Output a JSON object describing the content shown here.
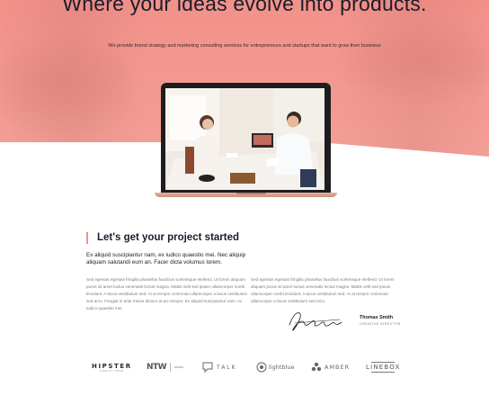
{
  "hero": {
    "title": "Where your ideas evolve into products.",
    "subtitle": "We provide brand strategy and marketing consulting services for entrepreneurs and startups that want to grow their business",
    "accent_color": "#f1918a"
  },
  "project": {
    "title": "Let's get your project started",
    "lead": "Ex aliquid suscipiantur nam, ex iudico quaestio mei. Nec aliquip aliquam salutandi eum an. Facer dicta volumus lorem.",
    "col_left": "Sed egestas egestas fringilla phasellus faucibus scelerisque eleifend. Ut lorem aliquam purus sit amet luctus venenatis lectus magna. Mattis velit sed ipsum ullamcorper morbi tincidunt. A lacus vestibulum sed. At at tempor commodo ullamcorper a lacus vestibulum sed arcu. Feugiat in ante metus dictum at arc tempor. Ex aliquid suscipiantur nam, ex iudico quaestio mei.",
    "col_right": "Sed egestas egestas fringilla phasellus faucibus scelerisque eleifend. Ut lorem aliquam purus sit amet luctus venenatis lectus magna. Mattis velit sed ipsum ullamcorper morbi tincidunt. A lacus vestibulum sed. At at tempor commodo ullamcorper a lacus vestibulum sed arcu.",
    "signer_name": "Thomas Smith",
    "signer_role": "CREATIVE DIRECTOR"
  },
  "logos": {
    "hipster": "HIPSTER",
    "hipster_sub": "QUALITY FOOD",
    "ntw": "NTW",
    "talk": "TALK",
    "lightblue": "lightblue",
    "amber": "AMBER",
    "linebox": "LINEBOX"
  }
}
